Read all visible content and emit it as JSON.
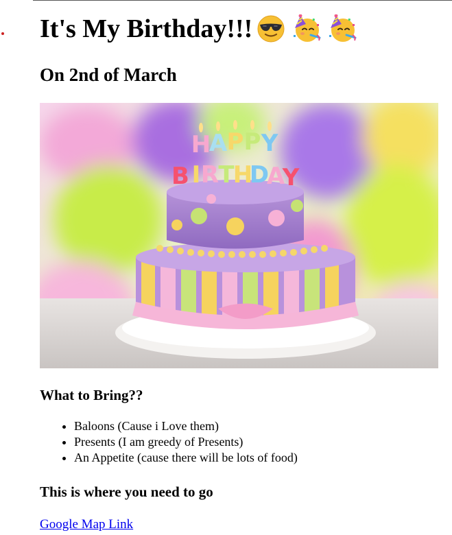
{
  "header": {
    "title": "It's My Birthday!!!",
    "emojis": [
      "smiling-face-with-sunglasses-icon",
      "partying-face-icon",
      "partying-face-icon"
    ]
  },
  "subtitle": "On 2nd of March",
  "image": {
    "alt": "Birthday cake",
    "candle_text_top": "HAPPY",
    "candle_text_bottom": "BIRTHDAY"
  },
  "bring_section": {
    "heading": "What to Bring??",
    "items": [
      "Baloons (Cause i Love them)",
      "Presents (I am greedy of Presents)",
      "An Appetite (cause there will be lots of food)"
    ]
  },
  "location_section": {
    "heading": "This is where you need to go",
    "link_text": "Google Map Link"
  },
  "colors": {
    "link": "#0000ee",
    "text": "#000000",
    "background": "#ffffff"
  }
}
